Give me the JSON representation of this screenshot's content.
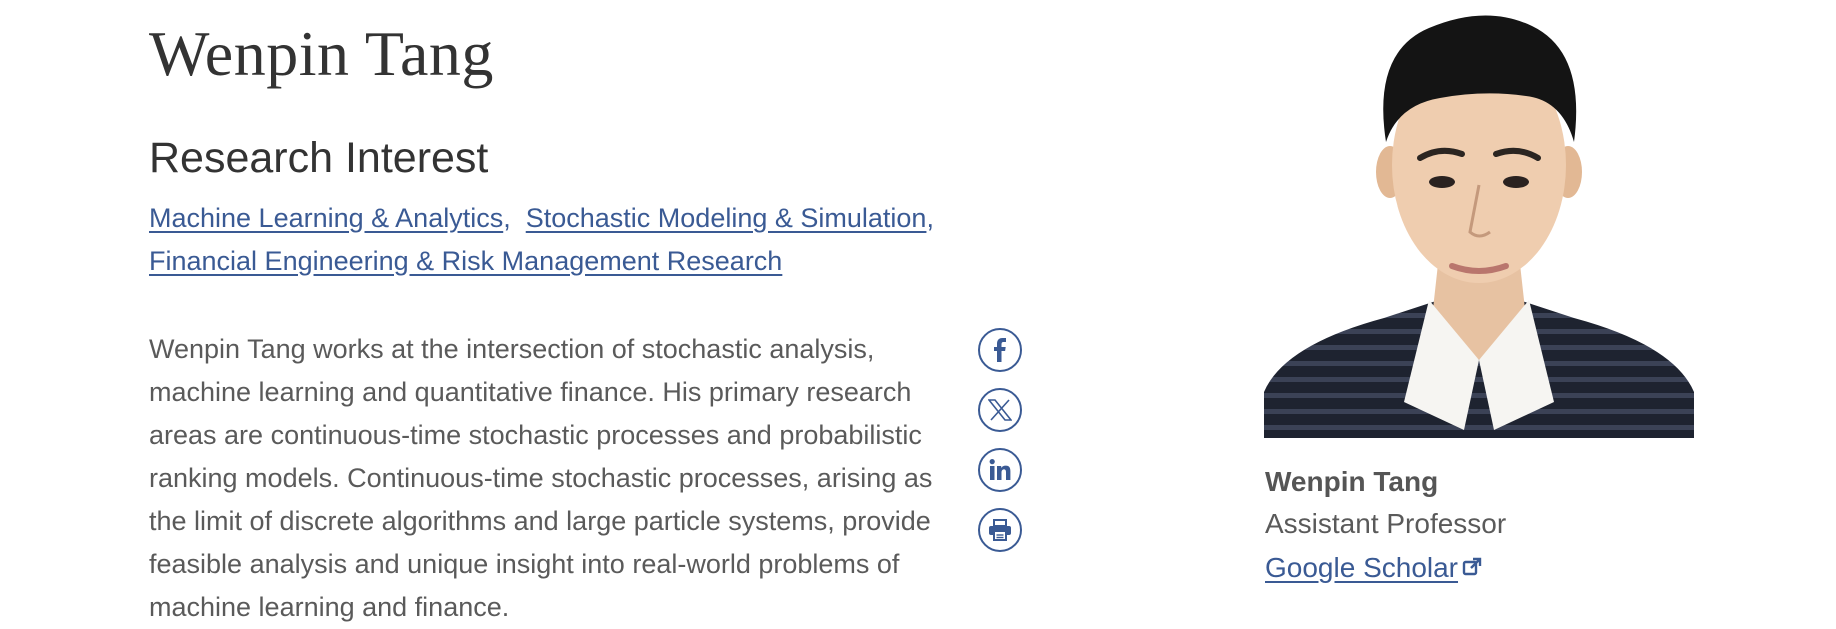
{
  "page": {
    "name": "Wenpin Tang",
    "research_heading": "Research Interest"
  },
  "research_interests": {
    "items": [
      "Machine Learning & Analytics",
      "Stochastic Modeling & Simulation",
      "Financial Engineering & Risk Management Research"
    ]
  },
  "bio": {
    "text": "Wenpin Tang works at the intersection of stochastic analysis, machine learning and quantitative finance. His primary research areas are continuous-time stochastic processes and probabilistic ranking models. Continuous-time stochastic processes, arising as the limit of discrete algorithms and large particle systems, provide feasible analysis and unique insight into real-world problems of machine learning and finance."
  },
  "share": {
    "icons": [
      "facebook-icon",
      "x-twitter-icon",
      "linkedin-icon",
      "print-icon"
    ]
  },
  "profile": {
    "name": "Wenpin Tang",
    "title": "Assistant Professor",
    "link_label": "Google Scholar",
    "link_icon": "external-link-icon"
  },
  "colors": {
    "link": "#3a5a94",
    "heading": "#333333",
    "body_text": "#5a5a5a"
  }
}
